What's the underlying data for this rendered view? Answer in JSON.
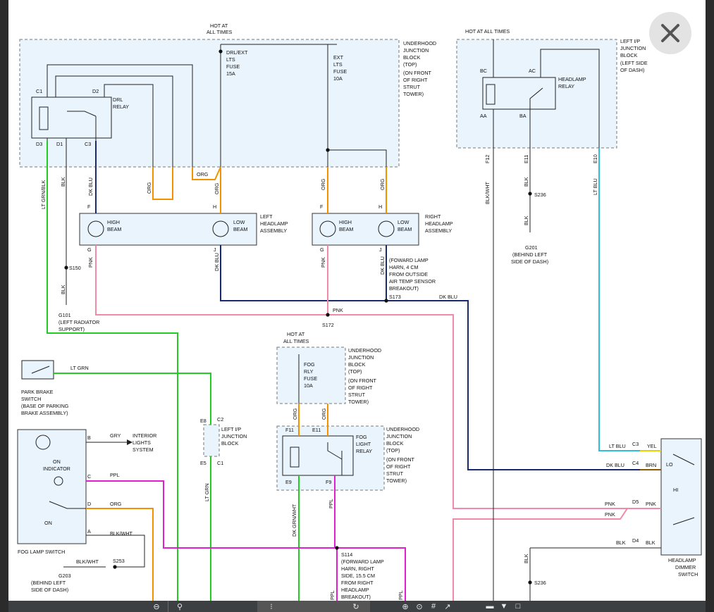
{
  "close_label": "✕",
  "labels": {
    "hot_top": [
      "HOT AT",
      "ALL TIMES"
    ],
    "hot_right": "HOT AT ALL TIMES",
    "hot_fog": [
      "HOT AT",
      "ALL TIMES"
    ],
    "ujb_top": [
      "UNDERHOOD",
      "JUNCTION",
      "BLOCK",
      "(TOP)",
      "(ON FRONT",
      "OF RIGHT",
      "STRUT",
      "TOWER)"
    ],
    "drl_fuse": [
      "DRL/EXT",
      "LTS",
      "FUSE",
      "15A"
    ],
    "ext_fuse": [
      "EXT",
      "LTS",
      "FUSE",
      "10A"
    ],
    "drl_relay": [
      "DRL",
      "RELAY"
    ],
    "c1": "C1",
    "d2": "D2",
    "d3": "D3",
    "d1": "D1",
    "c3": "C3",
    "lip_top": [
      "LEFT I/P",
      "JUNCTION",
      "BLOCK",
      "(LEFT SIDE",
      "OF DASH)"
    ],
    "bc": "BC",
    "ac": "AC",
    "aa": "AA",
    "ba": "BA",
    "hl_relay": [
      "HEADLAMP",
      "RELAY"
    ],
    "f12": "F12",
    "e11": "E11",
    "e10": "E10",
    "c1b": "C1",
    "blkwht": "BLK/WHT",
    "blk": "BLK",
    "ltblu": "LT BLU",
    "s236": "S236",
    "g201": [
      "G201",
      "(BEHIND LEFT",
      "SIDE OF DASH)"
    ],
    "ltgrnblk": "LT GRN/BLK",
    "dkblu": "DK BLU",
    "org": "ORG",
    "pnk": "PNK",
    "f": "F",
    "h": "H",
    "g": "G",
    "j": "J",
    "high_beam": [
      "HIGH",
      "BEAM"
    ],
    "low_beam": [
      "LOW",
      "BEAM"
    ],
    "left_hl": [
      "LEFT",
      "HEADLAMP",
      "ASSEMBLY"
    ],
    "right_hl": [
      "RIGHT",
      "HEADLAMP",
      "ASSEMBLY"
    ],
    "s150": "S150",
    "g101": [
      "G101",
      "(LEFT RADIATOR",
      "SUPPORT)"
    ],
    "fwd_harn": [
      "(FOWARD LAMP",
      "HARN, 4 CM",
      "FROM OUTSIDE",
      "AIR TEMP SENSOR",
      "BREAKOUT)"
    ],
    "s173": "S173",
    "s172": "S172",
    "ltgrn": "LT GRN",
    "park_brake": [
      "PARK BRAKE",
      "SWITCH",
      "(BASE OF PARKING",
      "BRAKE ASSEMBLY)"
    ],
    "ujb_fog": [
      "UNDERHOOD",
      "JUNCTION",
      "BLOCK",
      "(TOP)",
      "(ON FRONT",
      "OF RIGHT",
      "STRUT",
      "TOWER)"
    ],
    "fog_fuse": [
      "FOG",
      "RLY",
      "FUSE",
      "10A"
    ],
    "f11": "F11",
    "e11b": "E11",
    "fog_relay": [
      "FOG",
      "LIGHT",
      "RELAY"
    ],
    "e9": "E9",
    "f9": "F9",
    "e8": "E8",
    "c2": "C2",
    "e5": "E5",
    "lip_mid": [
      "LEFT I/P",
      "JUNCTION",
      "BLOCK"
    ],
    "b": "B",
    "c": "C",
    "d": "D",
    "a": "A",
    "gry": "GRY",
    "interior": [
      "INTERIOR",
      "LIGHTS",
      "SYSTEM"
    ],
    "on_ind": [
      "ON",
      "INDICATOR"
    ],
    "on": "ON",
    "ppl": "PPL",
    "fog_switch": "FOG LAMP SWITCH",
    "s253": "S253",
    "g203": [
      "G203",
      "(BEHIND LEFT",
      "SIDE OF DASH)"
    ],
    "dkgrnwht": "DK GRN/WHT",
    "s114": [
      "S114",
      "(FORWARD LAMP",
      "HARN, RIGHT",
      "SIDE, 15.5 CM",
      "FROM RIGHT",
      "HEADLAMP",
      "BREAKOUT)"
    ],
    "c3b": "C3",
    "c4": "C4",
    "d5": "D5",
    "d4": "D4",
    "yel": "YEL",
    "brn": "BRN",
    "lo": "LO",
    "hi": "HI",
    "dimmer": [
      "HEADLAMP",
      "DIMMER",
      "SWITCH"
    ]
  },
  "colors": {
    "green": "#22cc22",
    "orange": "#f39200",
    "pink": "#f08aa8",
    "navy": "#1a2a6e",
    "cyan": "#2dbfd8",
    "magenta": "#e020d0",
    "black": "#222222",
    "yellow": "#e6d200",
    "brown": "#8b5a00"
  }
}
